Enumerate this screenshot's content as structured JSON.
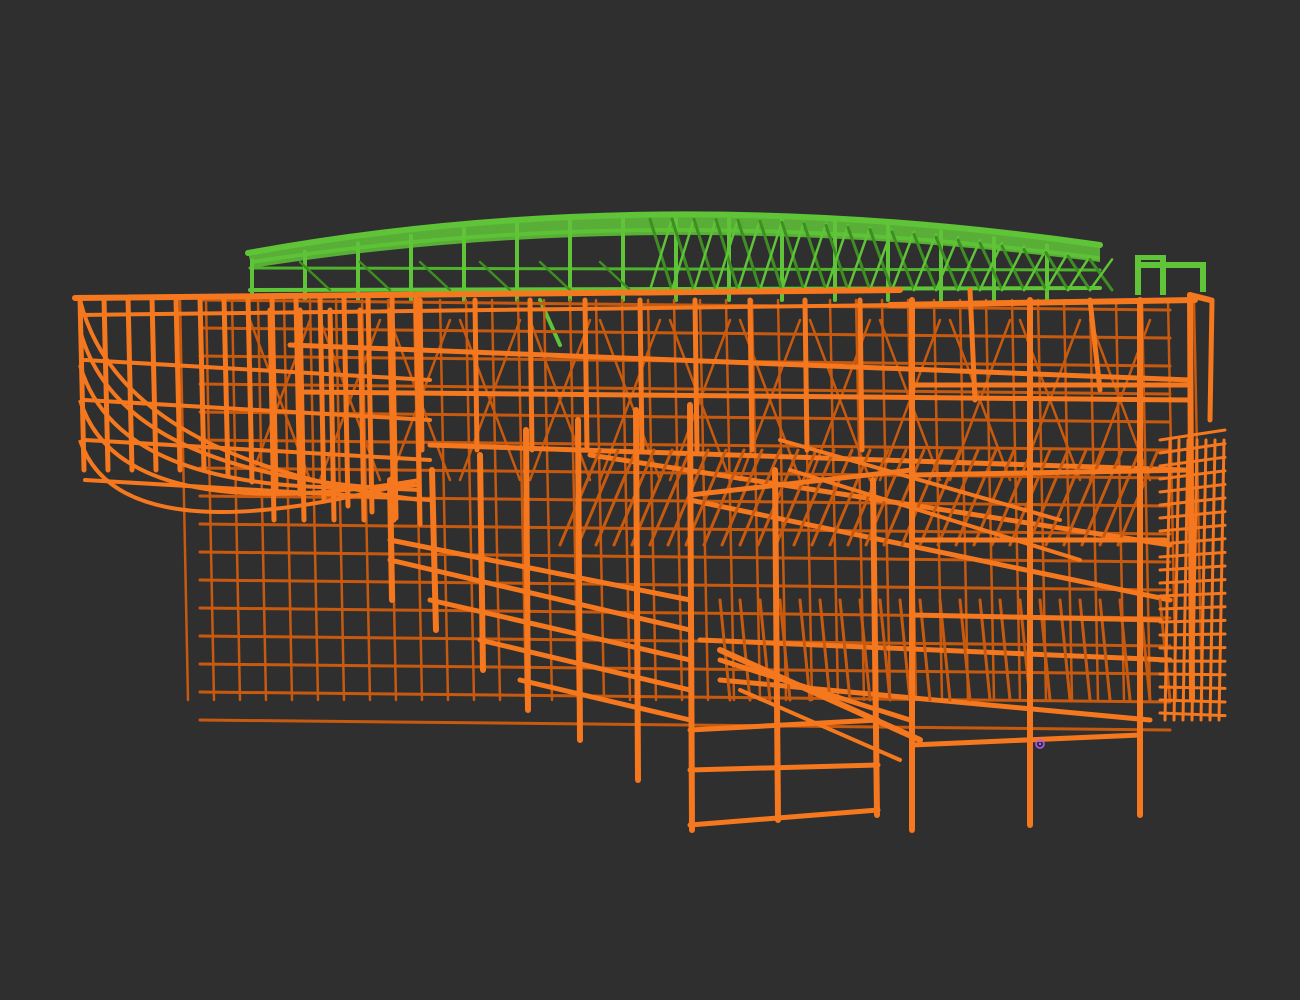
{
  "viewer": {
    "background_color": "#2f2f2f"
  },
  "model": {
    "layers": [
      {
        "id": "roof-steel",
        "color": "#5fc437",
        "shade_color": "#3e8f22"
      },
      {
        "id": "frame-steel",
        "color": "#f5781e",
        "shade_color": "#c85a10"
      }
    ]
  },
  "cursor": {
    "icon": "selection-marker-icon",
    "color": "#b05cff"
  }
}
